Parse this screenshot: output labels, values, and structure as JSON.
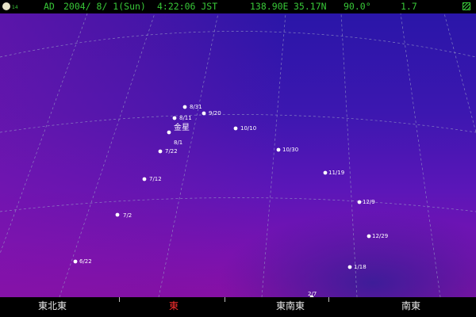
{
  "status": {
    "moon_age": "14",
    "era": "AD",
    "date": "2004/ 8/ 1(Sun)",
    "time": "4:22:06 JST",
    "longitude": "138.90E",
    "latitude": "35.17N",
    "field": "90.0°",
    "magnitude": "1.7"
  },
  "planet": {
    "name": "金星"
  },
  "positions": [
    {
      "label": "6/22"
    },
    {
      "label": "7/2"
    },
    {
      "label": "7/12"
    },
    {
      "label": "7/22"
    },
    {
      "label": "8/1"
    },
    {
      "label": "8/11"
    },
    {
      "label": "8/31"
    },
    {
      "label": "9/20"
    },
    {
      "label": "10/10"
    },
    {
      "label": "10/30"
    },
    {
      "label": "11/19"
    },
    {
      "label": "12/9"
    },
    {
      "label": "12/29"
    },
    {
      "label": "1/18"
    },
    {
      "label": "2/7"
    }
  ],
  "horizon": {
    "labels": [
      {
        "text": "東北東",
        "color": "#e8e8e8"
      },
      {
        "text": "東",
        "color": "#ff3030"
      },
      {
        "text": "東南東",
        "color": "#e8e8e8"
      },
      {
        "text": "南東",
        "color": "#e8e8e8"
      }
    ]
  },
  "colors": {
    "status_text": "#38c838",
    "east_highlight": "#ff3030",
    "grid": "#9aa0c8"
  }
}
